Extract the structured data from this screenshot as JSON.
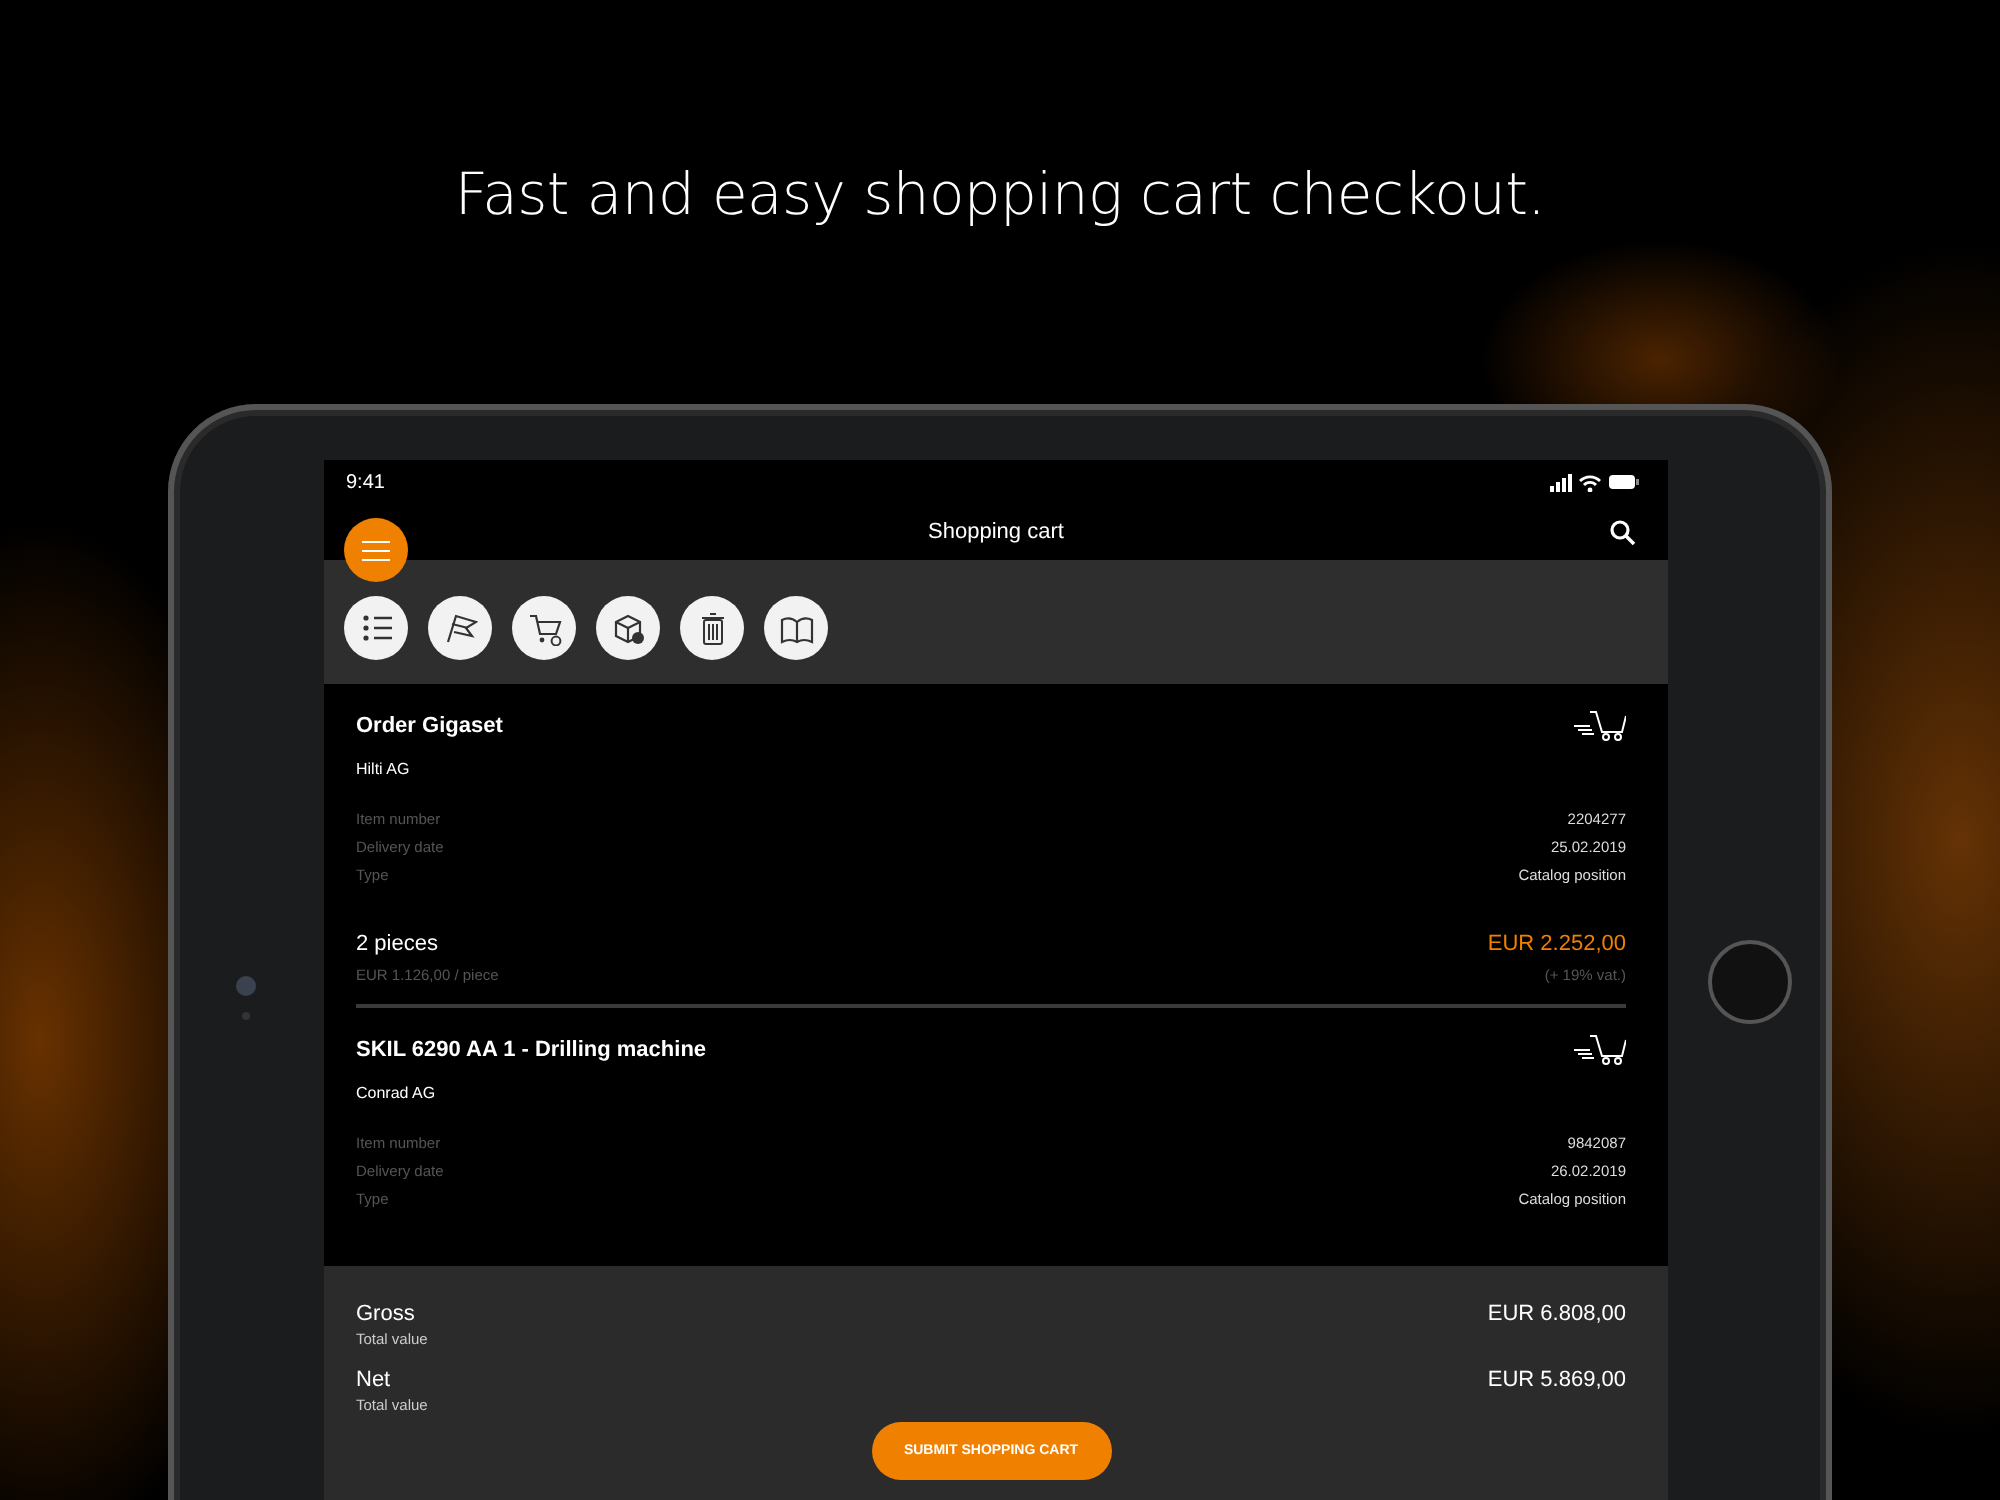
{
  "headline": "Fast and easy shopping cart checkout.",
  "status_bar": {
    "time": "9:41"
  },
  "header": {
    "title": "Shopping cart"
  },
  "items": [
    {
      "title": "Order Gigaset",
      "supplier": "Hilti AG",
      "details": [
        {
          "label": "Item number",
          "value": "2204277"
        },
        {
          "label": "Delivery date",
          "value": "25.02.2019"
        },
        {
          "label": "Type",
          "value": "Catalog position"
        }
      ],
      "quantity": "2 pieces",
      "unit_price": "EUR 1.126,00 / piece",
      "price": "EUR 2.252,00",
      "vat": "(+ 19% vat.)"
    },
    {
      "title": "SKIL 6290 AA 1 - Drilling machine",
      "supplier": "Conrad AG",
      "details": [
        {
          "label": "Item number",
          "value": "9842087"
        },
        {
          "label": "Delivery date",
          "value": "26.02.2019"
        },
        {
          "label": "Type",
          "value": "Catalog position"
        }
      ]
    }
  ],
  "totals": [
    {
      "label": "Gross",
      "sublabel": "Total value",
      "amount": "EUR 6.808,00"
    },
    {
      "label": "Net",
      "sublabel": "Total value",
      "amount": "EUR 5.869,00"
    }
  ],
  "submit_button": "SUBMIT SHOPPING CART"
}
